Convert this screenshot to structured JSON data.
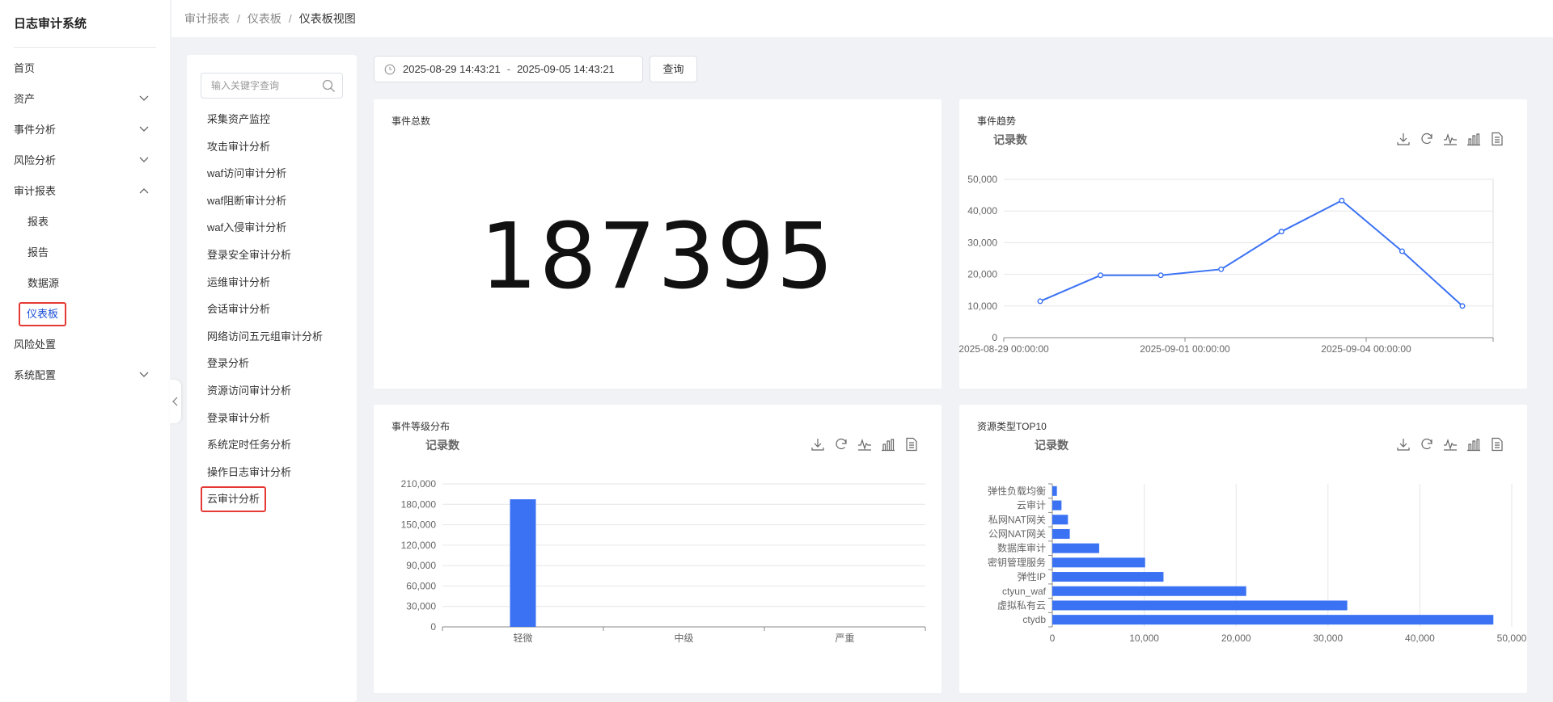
{
  "app": {
    "title": "日志审计系统"
  },
  "sidebar": {
    "items": [
      {
        "label": "首页"
      },
      {
        "label": "资产"
      },
      {
        "label": "事件分析"
      },
      {
        "label": "风险分析"
      },
      {
        "label": "审计报表"
      },
      {
        "label": "报表"
      },
      {
        "label": "报告"
      },
      {
        "label": "数据源"
      },
      {
        "label": "仪表板"
      },
      {
        "label": "风险处置"
      },
      {
        "label": "系统配置"
      }
    ]
  },
  "breadcrumb": {
    "items": [
      "审计报表",
      "仪表板"
    ],
    "current": "仪表板视图",
    "separator": "/"
  },
  "search": {
    "placeholder": "输入关键字查询",
    "value": ""
  },
  "categories": [
    "采集资产监控",
    "攻击审计分析",
    "waf访问审计分析",
    "waf阻断审计分析",
    "waf入侵审计分析",
    "登录安全审计分析",
    "运维审计分析",
    "会话审计分析",
    "网络访问五元组审计分析",
    "登录分析",
    "资源访问审计分析",
    "登录审计分析",
    "系统定时任务分析",
    "操作日志审计分析",
    "云审计分析"
  ],
  "date_range": {
    "start": "2025-08-29 14:43:21",
    "separator": "-",
    "end": "2025-09-05 14:43:21"
  },
  "query_button": {
    "label": "查询"
  },
  "cards": {
    "total": {
      "title": "事件总数",
      "value": "187395"
    },
    "trend": {
      "title": "事件趋势",
      "chart_title": "记录数"
    },
    "level": {
      "title": "事件等级分布",
      "chart_title": "记录数"
    },
    "top10": {
      "title": "资源类型TOP10",
      "chart_title": "记录数"
    }
  },
  "colors": {
    "accent": "#3b72f4",
    "highlight_border": "#e53935"
  },
  "chart_data": [
    {
      "type": "line",
      "title": "记录数",
      "x": [
        "2025-08-29",
        "2025-08-30",
        "2025-08-31",
        "2025-09-01",
        "2025-09-02",
        "2025-09-03",
        "2025-09-04",
        "2025-09-05"
      ],
      "x_tick_labels": [
        "2025-08-29 00:00:00",
        "2025-09-01 00:00:00",
        "2025-09-04 00:00:00"
      ],
      "values": [
        11500,
        19700,
        19700,
        21600,
        33500,
        43300,
        27300,
        10000
      ],
      "ylim": [
        0,
        50000
      ],
      "y_ticks": [
        "0",
        "10,000",
        "20,000",
        "30,000",
        "40,000",
        "50,000"
      ],
      "grid": true
    },
    {
      "type": "bar",
      "title": "记录数",
      "categories": [
        "轻微",
        "中级",
        "严重"
      ],
      "values": [
        187395,
        0,
        0
      ],
      "ylim": [
        0,
        210000
      ],
      "y_ticks": [
        "0",
        "30,000",
        "60,000",
        "90,000",
        "120,000",
        "150,000",
        "180,000",
        "210,000"
      ],
      "grid": true
    },
    {
      "type": "bar",
      "orientation": "horizontal",
      "title": "记录数",
      "categories": [
        "弹性负载均衡",
        "云审计",
        "私网NAT网关",
        "公网NAT网关",
        "数据库审计",
        "密钥管理服务",
        "弹性IP",
        "ctyun_waf",
        "虚拟私有云",
        "ctydb"
      ],
      "values": [
        500,
        1000,
        1700,
        1900,
        5100,
        10100,
        12100,
        21100,
        32100,
        48000
      ],
      "xlim": [
        0,
        50000
      ],
      "x_ticks": [
        "0",
        "10,000",
        "20,000",
        "30,000",
        "40,000",
        "50,000"
      ],
      "grid": true
    }
  ]
}
